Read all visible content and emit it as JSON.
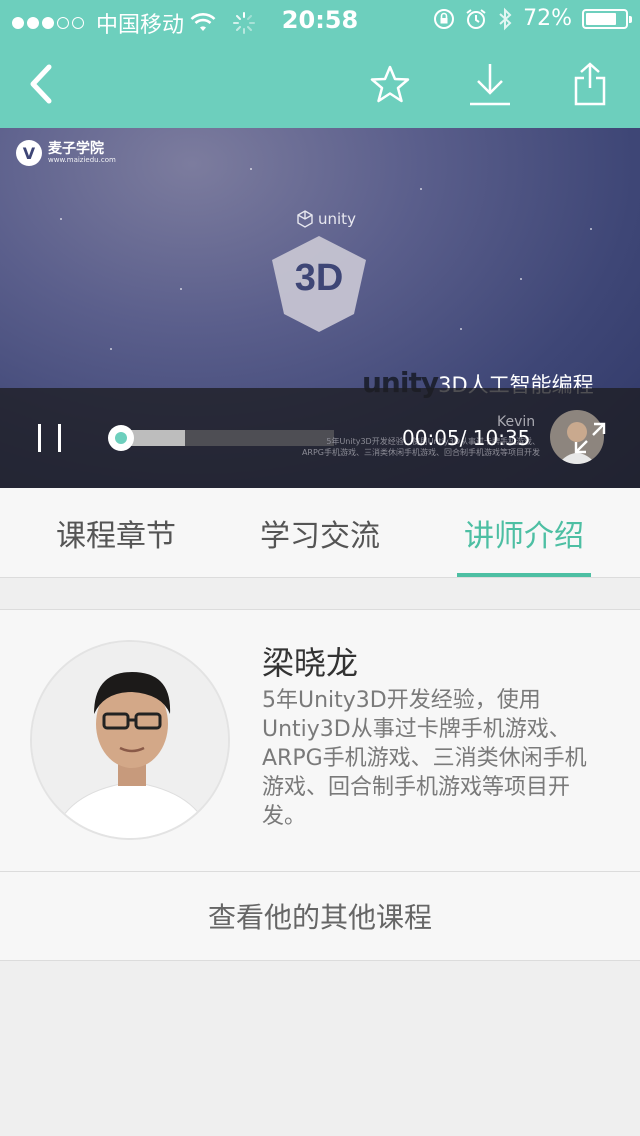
{
  "status_bar": {
    "carrier": "中国移动",
    "time": "20:58",
    "battery": "72%"
  },
  "nav": {
    "icons": [
      "back-icon",
      "star-icon",
      "download-icon",
      "share-icon"
    ]
  },
  "video": {
    "brand_name": "麦子学院",
    "brand_url": "www.maiziedu.com",
    "unity_mark": "unity",
    "badge_text": "3D",
    "title_unity": "unity",
    "title_rest": "3D人工智能编程",
    "current_time": "00:05",
    "total_time": "10:35",
    "buffered_fraction": 0.31,
    "played_fraction": 0.01,
    "instructor_tag": "Kevin",
    "faint_line_1": "5年Unity3D开发经验，使用Untiy3D从事过卡牌手机游戏、",
    "faint_line_2": "ARPG手机游戏、三消类休闲手机游戏、回合制手机游戏等项目开发"
  },
  "tabs": [
    {
      "label": "课程章节",
      "active": false
    },
    {
      "label": "学习交流",
      "active": false
    },
    {
      "label": "讲师介绍",
      "active": true
    }
  ],
  "instructor": {
    "name": "梁晓龙",
    "bio": "5年Unity3D开发经验，使用Untiy3D从事过卡牌手机游戏、ARPG手机游戏、三消类休闲手机游戏、回合制手机游戏等项目开发。",
    "more_courses": "查看他的其他课程"
  },
  "colors": {
    "accent": "#6dcfbd",
    "tab_active": "#4dbfa3"
  }
}
